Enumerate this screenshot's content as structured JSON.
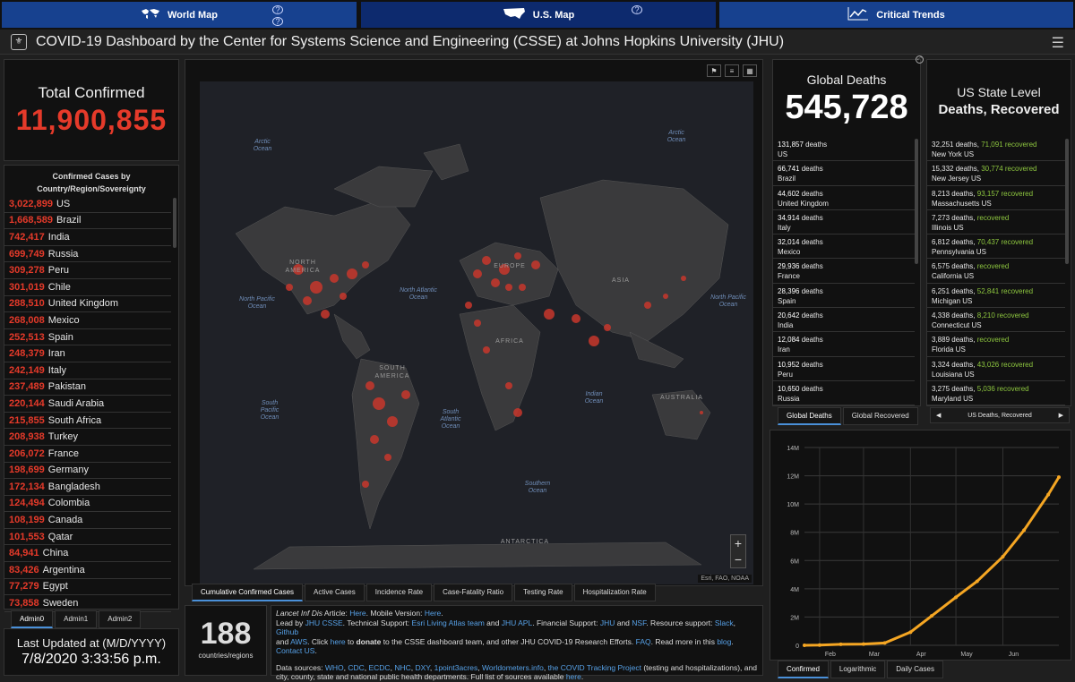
{
  "nav": {
    "world": {
      "label": "World Map"
    },
    "us": {
      "label": "U.S. Map"
    },
    "trends": {
      "label": "Critical Trends"
    },
    "info_glyph": "?"
  },
  "header": {
    "title": "COVID-19 Dashboard by the Center for Systems Science and Engineering (CSSE) at Johns Hopkins University (JHU)"
  },
  "total_confirmed": {
    "label": "Total Confirmed",
    "value": "11,900,855"
  },
  "country_list": {
    "header": "Confirmed Cases by Country/Region/Sovereignty",
    "items": [
      {
        "value": "3,022,899",
        "name": "US"
      },
      {
        "value": "1,668,589",
        "name": "Brazil"
      },
      {
        "value": "742,417",
        "name": "India"
      },
      {
        "value": "699,749",
        "name": "Russia"
      },
      {
        "value": "309,278",
        "name": "Peru"
      },
      {
        "value": "301,019",
        "name": "Chile"
      },
      {
        "value": "288,510",
        "name": "United Kingdom"
      },
      {
        "value": "268,008",
        "name": "Mexico"
      },
      {
        "value": "252,513",
        "name": "Spain"
      },
      {
        "value": "248,379",
        "name": "Iran"
      },
      {
        "value": "242,149",
        "name": "Italy"
      },
      {
        "value": "237,489",
        "name": "Pakistan"
      },
      {
        "value": "220,144",
        "name": "Saudi Arabia"
      },
      {
        "value": "215,855",
        "name": "South Africa"
      },
      {
        "value": "208,938",
        "name": "Turkey"
      },
      {
        "value": "206,072",
        "name": "France"
      },
      {
        "value": "198,699",
        "name": "Germany"
      },
      {
        "value": "172,134",
        "name": "Bangladesh"
      },
      {
        "value": "124,494",
        "name": "Colombia"
      },
      {
        "value": "108,199",
        "name": "Canada"
      },
      {
        "value": "101,553",
        "name": "Qatar"
      },
      {
        "value": "84,941",
        "name": "China"
      },
      {
        "value": "83,426",
        "name": "Argentina"
      },
      {
        "value": "77,279",
        "name": "Egypt"
      },
      {
        "value": "73,858",
        "name": "Sweden"
      }
    ]
  },
  "admin_tabs": [
    "Admin0",
    "Admin1",
    "Admin2"
  ],
  "last_updated": {
    "label": "Last Updated at (M/D/YYYY)",
    "value": "7/8/2020 3:33:56 p.m."
  },
  "map": {
    "oceans": [
      "Arctic Ocean",
      "Arctic Ocean",
      "North Pacific Ocean",
      "North Atlantic Ocean",
      "North Pacific Ocean",
      "South Pacific Ocean",
      "South Atlantic Ocean",
      "Indian Ocean",
      "Southern Ocean"
    ],
    "continents": [
      "NORTH AMERICA",
      "EUROPE",
      "ASIA",
      "AFRICA",
      "SOUTH AMERICA",
      "AUSTRALIA",
      "ANTARCTICA"
    ],
    "attribution": "Esri, FAO, NOAA",
    "tabs": [
      "Cumulative Confirmed Cases",
      "Active Cases",
      "Incidence Rate",
      "Case-Fatality Ratio",
      "Testing Rate",
      "Hospitalization Rate"
    ]
  },
  "countries_count": {
    "value": "188",
    "label": "countries/regions"
  },
  "info_text": {
    "l1_pre": "Lancet Inf Dis",
    "l1_mid": " Article: ",
    "here1": "Here",
    "l1_mob": ". Mobile Version: ",
    "here2": "Here",
    "dot": ".",
    "l2a": "Lead by ",
    "jhu_csse": "JHU CSSE",
    "l2b": ". Technical Support: ",
    "esri": "Esri Living Atlas team",
    "and1": " and ",
    "jhu_apl": "JHU APL",
    "l2c": ". Financial Support: ",
    "jhu": "JHU",
    "and2": " and ",
    "nsf": "NSF",
    "l2d": ". Resource support: ",
    "slack": "Slack",
    "comma1": ", ",
    "github": "Github",
    "and3": "and ",
    "aws": "AWS",
    "l3a": ". Click ",
    "here3": "here",
    "l3b": " to ",
    "donate": "donate",
    "l3c": " to the CSSE dashboard team, and other JHU COVID-19 Research Efforts. ",
    "faq": "FAQ",
    "l3d": ". Read more in this ",
    "blog": "blog",
    "contact": "Contact US",
    "sources_pre": "Data sources: ",
    "src1": "WHO",
    "src2": "CDC",
    "src3": "ECDC",
    "src4": "NHC",
    "src5": "DXY",
    "src6": "1point3acres",
    "src7": "Worldometers.info",
    "src8": "the COVID Tracking Project",
    "sep": ", ",
    "src_post": " (testing and hospitalizations), and city, county, state and national public health departments. Full list of sources available ",
    "here4": "here"
  },
  "global_deaths": {
    "label": "Global Deaths",
    "value": "545,728",
    "deaths_word": "deaths",
    "items": [
      {
        "value": "131,857",
        "name": "US"
      },
      {
        "value": "66,741",
        "name": "Brazil"
      },
      {
        "value": "44,602",
        "name": "United Kingdom"
      },
      {
        "value": "34,914",
        "name": "Italy"
      },
      {
        "value": "32,014",
        "name": "Mexico"
      },
      {
        "value": "29,936",
        "name": "France"
      },
      {
        "value": "28,396",
        "name": "Spain"
      },
      {
        "value": "20,642",
        "name": "India"
      },
      {
        "value": "12,084",
        "name": "Iran"
      },
      {
        "value": "10,952",
        "name": "Peru"
      },
      {
        "value": "10,650",
        "name": "Russia"
      }
    ],
    "tabs": [
      "Global Deaths",
      "Global Recovered"
    ]
  },
  "us_state": {
    "label1": "US State Level",
    "label2": "Deaths, Recovered",
    "deaths_word": "deaths,",
    "recovered_word": "recovered",
    "items": [
      {
        "deaths": "32,251",
        "recovered": "71,091",
        "name": "New York US"
      },
      {
        "deaths": "15,332",
        "recovered": "30,774",
        "name": "New Jersey US"
      },
      {
        "deaths": "8,213",
        "recovered": "93,157",
        "name": "Massachusetts US"
      },
      {
        "deaths": "7,273",
        "recovered": "",
        "name": "Illinois US"
      },
      {
        "deaths": "6,812",
        "recovered": "70,437",
        "name": "Pennsylvania US"
      },
      {
        "deaths": "6,575",
        "recovered": "",
        "name": "California US"
      },
      {
        "deaths": "6,251",
        "recovered": "52,841",
        "name": "Michigan US"
      },
      {
        "deaths": "4,338",
        "recovered": "8,210",
        "name": "Connecticut US"
      },
      {
        "deaths": "3,889",
        "recovered": "",
        "name": "Florida US"
      },
      {
        "deaths": "3,324",
        "recovered": "43,026",
        "name": "Louisiana US"
      },
      {
        "deaths": "3,275",
        "recovered": "5,036",
        "name": "Maryland US"
      }
    ],
    "nav_label": "US Deaths, Recovered"
  },
  "chart_tabs": [
    "Confirmed",
    "Logarithmic",
    "Daily Cases"
  ],
  "colors": {
    "accent_red": "#e53a2a",
    "recovered_green": "#8dc63f",
    "line_orange": "#f5a623",
    "nav_blue": "#17418f"
  },
  "chart_data": {
    "type": "line",
    "title": "",
    "xlabel": "",
    "ylabel": "",
    "x_ticks": [
      "Feb",
      "Mar",
      "Apr",
      "May",
      "Jun"
    ],
    "y_ticks": [
      "0",
      "2M",
      "4M",
      "6M",
      "8M",
      "10M",
      "12M",
      "14M"
    ],
    "ylim": [
      0,
      14000000
    ],
    "series": [
      {
        "x": [
          "2020-01-22",
          "2020-02-01",
          "2020-02-15",
          "2020-03-01",
          "2020-03-15",
          "2020-04-01",
          "2020-04-15",
          "2020-05-01",
          "2020-05-15",
          "2020-06-01",
          "2020-06-15",
          "2020-07-01",
          "2020-07-08"
        ],
        "values": [
          555,
          12000,
          69000,
          88000,
          169000,
          930000,
          2080000,
          3400000,
          4530000,
          6270000,
          8150000,
          10670000,
          11900855
        ]
      }
    ]
  }
}
